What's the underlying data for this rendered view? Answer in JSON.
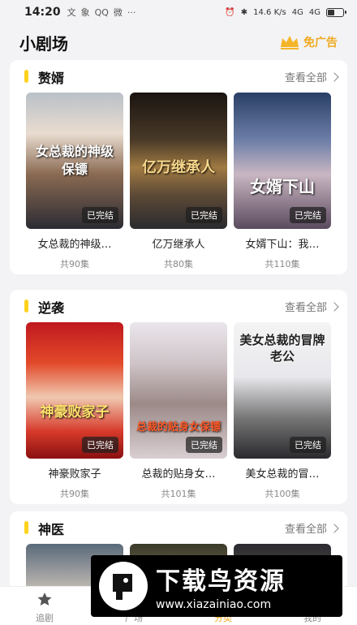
{
  "status": {
    "time": "14:20",
    "left_icons": [
      "文",
      "象",
      "QQ",
      "微"
    ],
    "more": "···",
    "speed": "14.6 K/s",
    "signal1": "4G",
    "signal2": "4G",
    "battery_level": 0.45
  },
  "header": {
    "title": "小剧场",
    "ad_free": "免广告"
  },
  "sections": [
    {
      "title": "赘婿",
      "more": "查看全部",
      "cards": [
        {
          "title": "女总裁的神级…",
          "count": "共90集",
          "badge": "已完结",
          "poster_text": "女总裁的神级保镖"
        },
        {
          "title": "亿万继承人",
          "count": "共80集",
          "badge": "已完结",
          "poster_text": "亿万继承人"
        },
        {
          "title": "女婿下山：我…",
          "count": "共110集",
          "badge": "已完结",
          "poster_text": "女婿下山"
        }
      ]
    },
    {
      "title": "逆袭",
      "more": "查看全部",
      "cards": [
        {
          "title": "神豪败家子",
          "count": "共90集",
          "badge": "已完结",
          "poster_text": "神豪败家子"
        },
        {
          "title": "总裁的贴身女…",
          "count": "共101集",
          "badge": "已完结",
          "poster_text": "总裁的贴身女保镖"
        },
        {
          "title": "美女总裁的冒…",
          "count": "共100集",
          "badge": "已完结",
          "poster_text": "美女总裁的冒牌老公"
        }
      ]
    },
    {
      "title": "神医",
      "more": "查看全部",
      "cards": []
    }
  ],
  "tabs": [
    {
      "label": "追剧"
    },
    {
      "label": "广场"
    },
    {
      "label": "分类"
    },
    {
      "label": "我的"
    }
  ],
  "watermark": {
    "text": "下载鸟资源",
    "url": "www.xiazainiao.com"
  }
}
